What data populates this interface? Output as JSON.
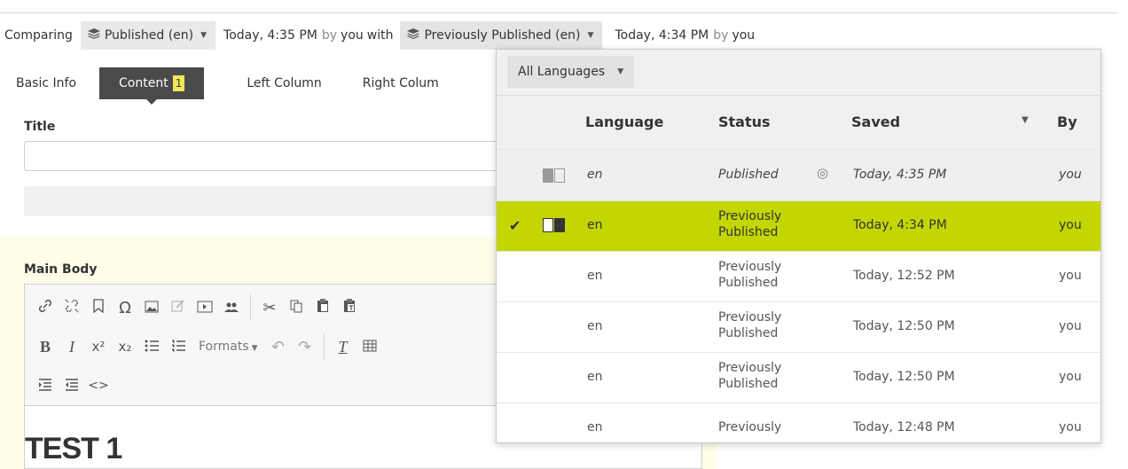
{
  "compare": {
    "comparing_label": "Comparing",
    "left_version": "Published (en)",
    "left_time": "Today, 4:35 PM",
    "by_label": "by",
    "left_user": "you",
    "with_label": "with",
    "right_version": "Previously Published (en)",
    "right_time": "Today, 4:34 PM",
    "right_user": "you"
  },
  "tabs": [
    {
      "label": "Basic Info",
      "active": false
    },
    {
      "label": "Content",
      "active": true,
      "badge": "1"
    },
    {
      "label": "Left Column",
      "active": false
    },
    {
      "label": "Right Colum",
      "active": false
    }
  ],
  "form": {
    "title_label": "Title",
    "title_value": "",
    "main_body_label": "Main Body"
  },
  "editor": {
    "formats_label": "Formats",
    "content_heading": "TEST 1"
  },
  "versions_panel": {
    "language_filter": "All Languages",
    "columns": {
      "language": "Language",
      "status": "Status",
      "saved": "Saved",
      "by": "By"
    },
    "sort_column": "saved",
    "rows": [
      {
        "language": "en",
        "status_line1": "Published",
        "status_line2": "",
        "saved": "Today, 4:35 PM",
        "by": "you",
        "current": true,
        "selected": false
      },
      {
        "language": "en",
        "status_line1": "Previously",
        "status_line2": "Published",
        "saved": "Today, 4:34 PM",
        "by": "you",
        "current": false,
        "selected": true
      },
      {
        "language": "en",
        "status_line1": "Previously",
        "status_line2": "Published",
        "saved": "Today, 12:52 PM",
        "by": "you",
        "current": false,
        "selected": false
      },
      {
        "language": "en",
        "status_line1": "Previously",
        "status_line2": "Published",
        "saved": "Today, 12:50 PM",
        "by": "you",
        "current": false,
        "selected": false
      },
      {
        "language": "en",
        "status_line1": "Previously",
        "status_line2": "Published",
        "saved": "Today, 12:50 PM",
        "by": "you",
        "current": false,
        "selected": false
      },
      {
        "language": "en",
        "status_line1": "Previously",
        "status_line2": "",
        "saved": "Today, 12:48 PM",
        "by": "you",
        "current": false,
        "selected": false
      }
    ]
  },
  "colors": {
    "selected_row": "#c4d600",
    "active_tab": "#4a4a4a",
    "badge": "#f2e65a",
    "main_section_bg": "#fefde8"
  }
}
